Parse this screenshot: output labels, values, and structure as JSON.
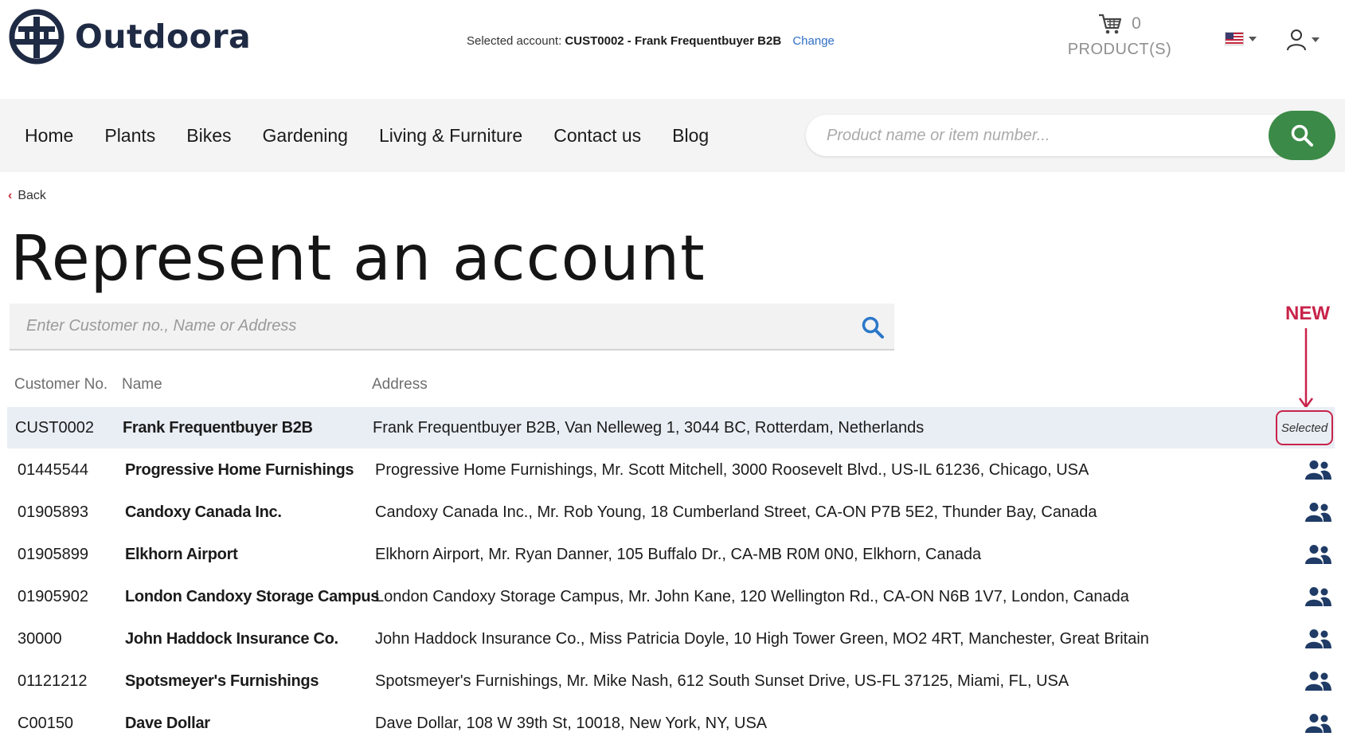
{
  "header": {
    "brand": "Outdoora",
    "selected_account_label": "Selected account:",
    "selected_account_value": "CUST0002 - Frank Frequentbuyer B2B",
    "change_label": "Change",
    "cart_count": "0",
    "cart_label": "PRODUCT(S)",
    "language_flag": "us-flag-icon"
  },
  "nav": {
    "items": [
      "Home",
      "Plants",
      "Bikes",
      "Gardening",
      "Living & Furniture",
      "Contact us",
      "Blog"
    ],
    "search_placeholder": "Product name or item number..."
  },
  "back_label": "Back",
  "page_title": "Represent an account",
  "customer_search_placeholder": "Enter Customer no., Name or Address",
  "annotation": {
    "label": "NEW",
    "color": "#c8234a"
  },
  "table": {
    "headers": {
      "customer_no": "Customer No.",
      "name": "Name",
      "address": "Address"
    },
    "selected_label": "Selected",
    "rows": [
      {
        "no": "CUST0002",
        "name": "Frank Frequentbuyer B2B",
        "address": "Frank Frequentbuyer B2B, Van Nelleweg 1, 3044 BC, Rotterdam, Netherlands",
        "selected": true
      },
      {
        "no": "01445544",
        "name": "Progressive Home Furnishings",
        "address": "Progressive Home Furnishings, Mr. Scott Mitchell, 3000 Roosevelt Blvd., US-IL 61236, Chicago, USA",
        "selected": false
      },
      {
        "no": "01905893",
        "name": "Candoxy Canada Inc.",
        "address": "Candoxy Canada Inc., Mr. Rob Young, 18 Cumberland Street, CA-ON P7B 5E2, Thunder Bay, Canada",
        "selected": false
      },
      {
        "no": "01905899",
        "name": "Elkhorn Airport",
        "address": "Elkhorn Airport, Mr. Ryan Danner, 105 Buffalo Dr., CA-MB R0M 0N0, Elkhorn, Canada",
        "selected": false
      },
      {
        "no": "01905902",
        "name": "London Candoxy Storage Campus",
        "address": "London Candoxy Storage Campus, Mr. John Kane, 120 Wellington Rd., CA-ON N6B 1V7, London, Canada",
        "selected": false
      },
      {
        "no": "30000",
        "name": "John Haddock Insurance Co.",
        "address": "John Haddock Insurance Co., Miss Patricia Doyle, 10 High Tower Green, MO2 4RT, Manchester, Great Britain",
        "selected": false
      },
      {
        "no": "01121212",
        "name": "Spotsmeyer's Furnishings",
        "address": "Spotsmeyer's Furnishings, Mr. Mike Nash, 612 South Sunset Drive, US-FL 37125, Miami, FL, USA",
        "selected": false
      },
      {
        "no": "C00150",
        "name": "Dave Dollar",
        "address": "Dave Dollar, 108 W 39th St, 10018, New York, NY, USA",
        "selected": false
      }
    ]
  },
  "colors": {
    "brand_dark": "#1f2a44",
    "search_button": "#3c8a47",
    "link": "#2f6fc6",
    "selected_row_bg": "#e9eef5",
    "accent_red": "#c8234a",
    "users_icon": "#1f3b66"
  }
}
